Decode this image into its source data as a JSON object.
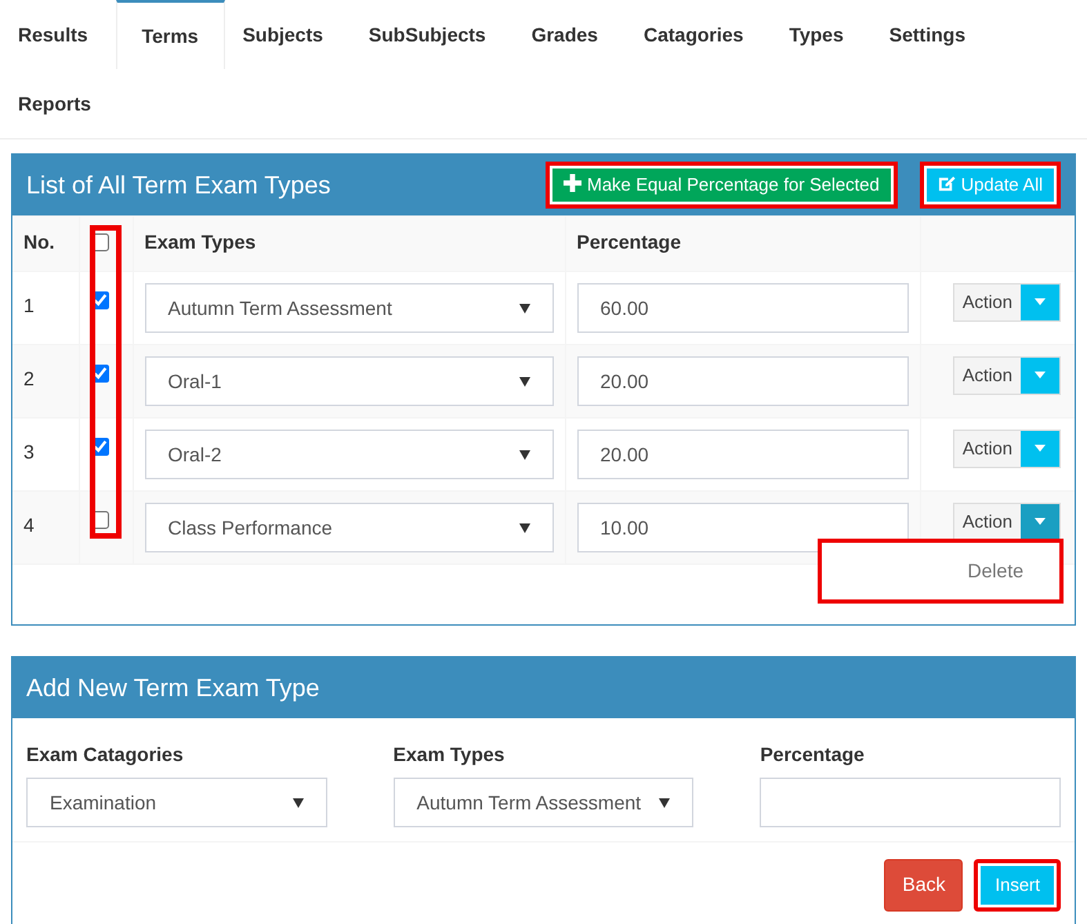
{
  "tabs": [
    {
      "label": "Results",
      "selected": false
    },
    {
      "label": "Terms",
      "selected": true
    },
    {
      "label": "Subjects",
      "selected": false
    },
    {
      "label": "SubSubjects",
      "selected": false
    },
    {
      "label": "Grades",
      "selected": false
    },
    {
      "label": "Catagories",
      "selected": false
    },
    {
      "label": "Types",
      "selected": false
    },
    {
      "label": "Settings",
      "selected": false
    },
    {
      "label": "Reports",
      "selected": false
    }
  ],
  "list_panel": {
    "title": "List of All Term Exam Types",
    "buttons": [
      {
        "kind": "equal",
        "label": "Make Equal Percentage for Selected",
        "highlighted": true
      },
      {
        "kind": "update",
        "label": "Update All",
        "highlighted": true
      }
    ],
    "columns": [
      "No.",
      "Exam Types",
      "Percentage"
    ],
    "select_all": {
      "checked": false
    },
    "checkbox_column_highlighted": true,
    "rows": [
      {
        "no": "1",
        "checked": true,
        "exam_type": "Autumn Term Assessment",
        "percentage": "60.00",
        "action": "Action",
        "menu_open": false
      },
      {
        "no": "2",
        "checked": true,
        "exam_type": "Oral-1",
        "percentage": "20.00",
        "action": "Action",
        "menu_open": false
      },
      {
        "no": "3",
        "checked": true,
        "exam_type": "Oral-2",
        "percentage": "20.00",
        "action": "Action",
        "menu_open": false
      },
      {
        "no": "4",
        "checked": false,
        "exam_type": "Class Performance",
        "percentage": "10.00",
        "action": "Action",
        "menu_open": true
      }
    ],
    "menu": {
      "items": [
        "Delete"
      ],
      "highlighted": true
    }
  },
  "add_panel": {
    "title": "Add New Term Exam Type",
    "fields": [
      {
        "kind": "select",
        "label": "Exam Catagories",
        "value": "Examination"
      },
      {
        "kind": "select",
        "label": "Exam Types",
        "value": "Autumn Term Assessment"
      },
      {
        "kind": "input",
        "label": "Percentage"
      }
    ],
    "buttons": [
      {
        "kind": "back",
        "label": "Back",
        "highlighted": false
      },
      {
        "kind": "insert",
        "label": "Insert",
        "highlighted": true
      }
    ]
  }
}
